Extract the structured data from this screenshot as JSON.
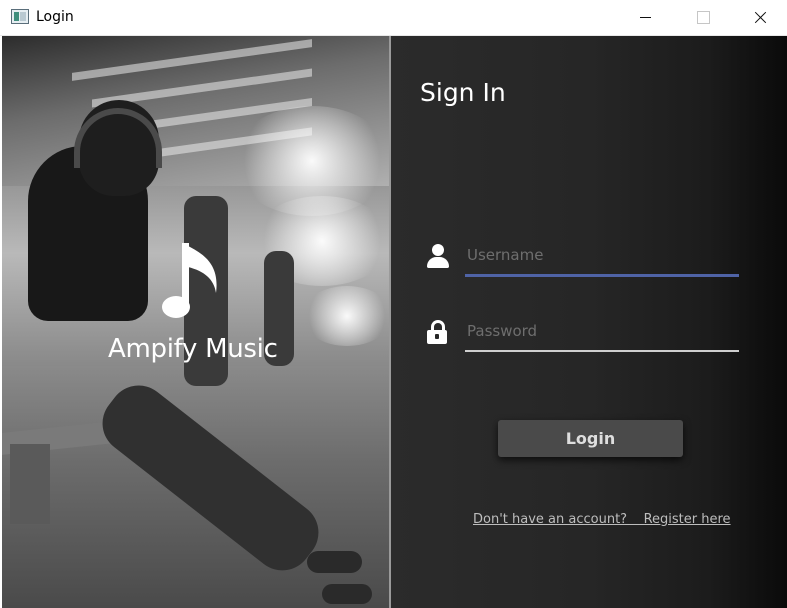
{
  "window": {
    "title": "Login",
    "controls": {
      "minimize": "minimize-icon",
      "maximize": "maximize-icon",
      "close": "close-icon"
    }
  },
  "brand": {
    "name": "Ampify Music",
    "icon": "music-note-icon"
  },
  "signin": {
    "title": "Sign In",
    "username": {
      "placeholder": "Username",
      "value": "",
      "icon": "user-icon"
    },
    "password": {
      "placeholder": "Password",
      "value": "",
      "icon": "lock-icon"
    },
    "login_label": "Login",
    "register_text": "Don't have an account?    Register here"
  },
  "colors": {
    "panel_background": "#262626",
    "username_underline": "#4f63a6",
    "password_underline": "#cfcfcf",
    "button_background": "#4a4a4a",
    "text": "#ffffff"
  }
}
